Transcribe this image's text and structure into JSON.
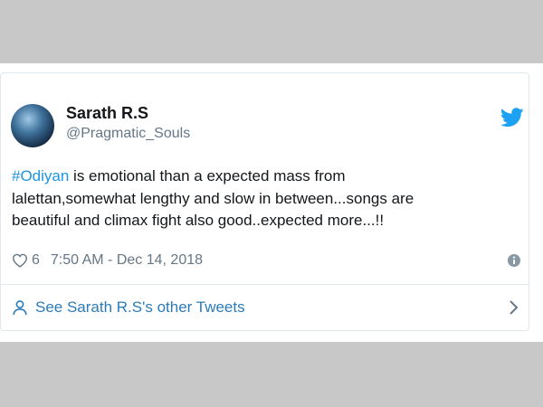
{
  "tweet": {
    "author_name": "Sarath R.S",
    "author_handle": "@Pragmatic_Souls",
    "hashtag": "#Odiyan",
    "line1_rest": " is emotional  than a expected mass from",
    "line2": "lalettan,somewhat lengthy and slow in between...songs are",
    "line3": "beautiful and climax fight also good..expected more...!!",
    "likes": "6",
    "timestamp": "7:50 AM - Dec 14, 2018"
  },
  "footer": {
    "see_more_label": "See Sarath R.S's other Tweets"
  },
  "icons": {
    "brand": "twitter-bird-icon",
    "like": "heart-icon",
    "info": "info-icon",
    "user": "user-icon",
    "chevron": "chevron-right-icon"
  },
  "colors": {
    "twitter_blue": "#1da1f2",
    "link_blue": "#2b7bb9",
    "hashtag_blue": "#1b95e0",
    "text": "#14171a",
    "muted": "#657786",
    "backdrop": "#c8c8c8"
  }
}
